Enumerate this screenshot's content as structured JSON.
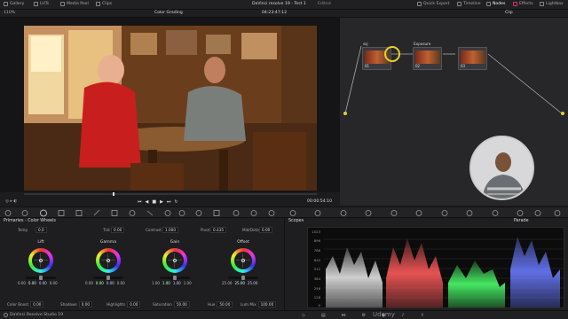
{
  "topbar": {
    "items_left": [
      "Gallery",
      "LUTs",
      "Media Pool",
      "Clips"
    ],
    "title": "DaVinci resolve 19 - Test 1",
    "edited": "Edited",
    "items_right": [
      "Quick Export",
      "Timeline",
      "Nodes",
      "Effects",
      "Lightbox"
    ]
  },
  "viewer": {
    "zoom": "110%",
    "mode_label": "Color Grading",
    "timecode_top": "04:23:47:12",
    "timecode": "00:00:54:10"
  },
  "nodes": {
    "mode": "Clip",
    "node_list": [
      {
        "name": "ssj",
        "label": "01"
      },
      {
        "name": "Exposure",
        "label": "02"
      },
      {
        "name": "",
        "label": "03"
      }
    ]
  },
  "primaries": {
    "title": "Primaries - Color Wheels",
    "temp_label": "Temp",
    "temp": "0.0",
    "tint_label": "Tint",
    "tint": "0.00",
    "contrast_label": "Contrast",
    "contrast": "1.000",
    "pivot_label": "Pivot",
    "pivot": "0.435",
    "middetail_label": "Mid/Detail",
    "middetail": "0.00",
    "wheels": [
      {
        "name": "Lift",
        "values": [
          "0.00",
          "0.00",
          "0.00",
          "0.00"
        ]
      },
      {
        "name": "Gamma",
        "values": [
          "0.00",
          "0.00",
          "0.00",
          "0.00"
        ]
      },
      {
        "name": "Gain",
        "values": [
          "1.00",
          "1.00",
          "1.00",
          "1.00"
        ]
      },
      {
        "name": "Offset",
        "values": [
          "25.00",
          "25.00",
          "25.00"
        ]
      }
    ],
    "bottom": {
      "colorboost_label": "Color Boost",
      "colorboost": "0.00",
      "shadows_label": "Shadows",
      "shadows": "0.00",
      "highlights_label": "Highlights",
      "highlights": "0.00",
      "saturation_label": "Saturation",
      "saturation": "50.00",
      "hue_label": "Hue",
      "hue": "50.00",
      "lummix_label": "Lum Mix",
      "lummix": "100.00"
    }
  },
  "scopes": {
    "title": "Scopes",
    "mode": "Parade",
    "scale": [
      "1023",
      "896",
      "768",
      "640",
      "512",
      "384",
      "256",
      "128",
      "0"
    ]
  },
  "statusbar": {
    "app": "DaVinci Resolve Studio 19",
    "watermark": "Udemy"
  },
  "colors": {
    "accent": "#e0306a",
    "selection": "#e6d12a",
    "red": "#ff5a5a",
    "green": "#4aff6a",
    "blue": "#6a7aff"
  }
}
